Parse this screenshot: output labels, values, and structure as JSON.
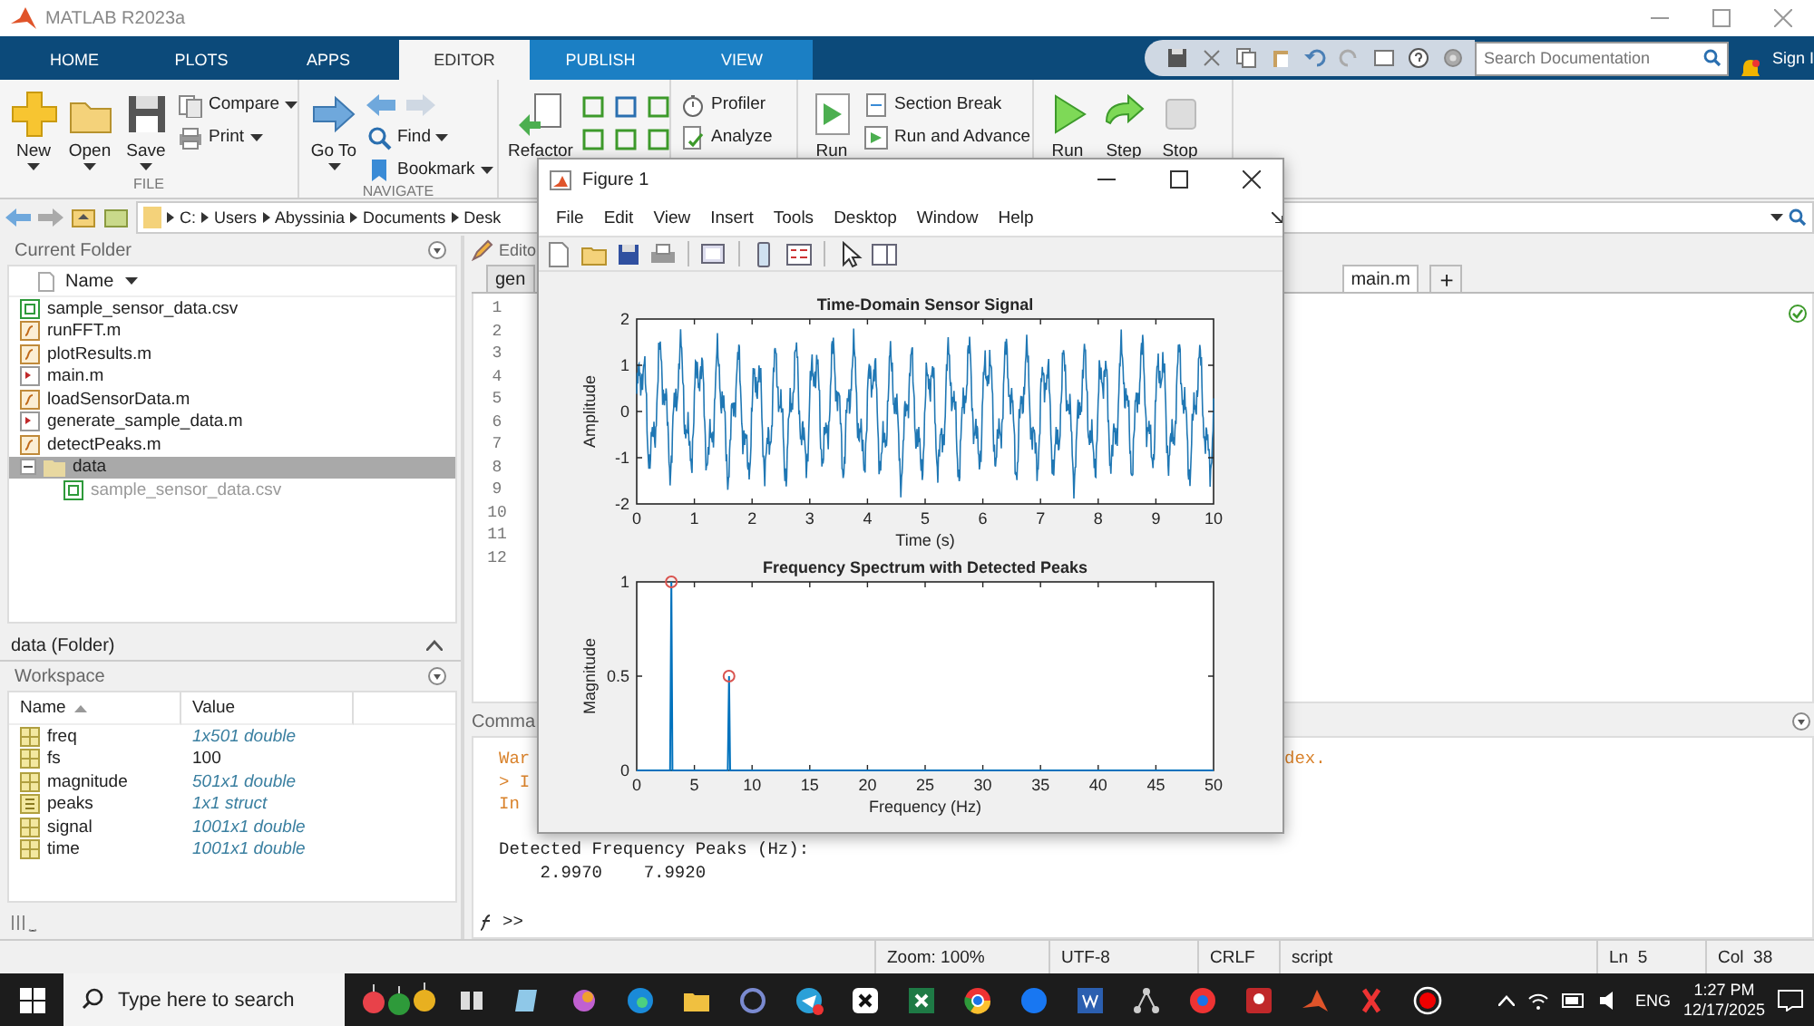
{
  "window": {
    "title": "MATLAB R2023a"
  },
  "ribbon": {
    "tabs": [
      {
        "label": "HOME",
        "selected": false,
        "contextual": false
      },
      {
        "label": "PLOTS",
        "selected": false,
        "contextual": false
      },
      {
        "label": "APPS",
        "selected": false,
        "contextual": false
      },
      {
        "label": "EDITOR",
        "selected": true,
        "contextual": true
      },
      {
        "label": "PUBLISH",
        "selected": false,
        "contextual": true
      },
      {
        "label": "VIEW",
        "selected": false,
        "contextual": true
      }
    ],
    "search": {
      "placeholder": "Search Documentation"
    },
    "sign_in": "Sign I",
    "groups": [
      {
        "label": "FILE",
        "items": [
          {
            "kind": "large",
            "label": "New",
            "menu": true
          },
          {
            "kind": "large",
            "label": "Open",
            "menu": true
          },
          {
            "kind": "large",
            "label": "Save",
            "menu": true
          },
          {
            "kind": "stack",
            "items": [
              {
                "kind": "button",
                "label": "Compare",
                "menu": true
              },
              {
                "kind": "button",
                "label": "Print",
                "menu": true
              }
            ]
          }
        ]
      },
      {
        "label": "NAVIGATE",
        "items": [
          {
            "kind": "large",
            "label": "Go To",
            "menu": true
          },
          {
            "kind": "stack",
            "items": [
              {
                "kind": "arrows"
              },
              {
                "kind": "button",
                "label": "Find",
                "menu": true
              },
              {
                "kind": "button",
                "label": "Bookmark",
                "menu": true
              }
            ]
          }
        ]
      },
      {
        "items": [
          {
            "kind": "large",
            "label": "Refactor",
            "menu": false
          },
          {
            "kind": "grid"
          }
        ]
      },
      {
        "items": [
          {
            "kind": "stack",
            "items": [
              {
                "kind": "button",
                "label": "Profiler",
                "menu": false
              },
              {
                "kind": "button",
                "label": "Analyze",
                "menu": false
              }
            ]
          }
        ]
      },
      {
        "items": [
          {
            "kind": "large",
            "label": "Run",
            "menu": false
          },
          {
            "kind": "stack",
            "items": [
              {
                "kind": "button",
                "label": "Section Break",
                "menu": false
              },
              {
                "kind": "button",
                "label": "Run and Advance",
                "menu": false
              }
            ]
          }
        ]
      },
      {
        "items": [
          {
            "kind": "large",
            "label": "Run",
            "menu": false
          },
          {
            "kind": "large",
            "label": "Step",
            "menu": false
          },
          {
            "kind": "large",
            "label": "Stop",
            "menu": false
          }
        ]
      }
    ]
  },
  "address": {
    "segments": [
      "C:",
      "Users",
      "Abyssinia",
      "Documents",
      "Desk"
    ]
  },
  "current_folder": {
    "title": "Current Folder",
    "column": "Name",
    "items": [
      {
        "name": "sample_sensor_data.csv",
        "kind": "csv",
        "selected": false
      },
      {
        "name": "runFFT.m",
        "kind": "function",
        "selected": false
      },
      {
        "name": "plotResults.m",
        "kind": "function",
        "selected": false
      },
      {
        "name": "main.m",
        "kind": "script",
        "selected": false
      },
      {
        "name": "loadSensorData.m",
        "kind": "function",
        "selected": false
      },
      {
        "name": "generate_sample_data.m",
        "kind": "script",
        "selected": false
      },
      {
        "name": "detectPeaks.m",
        "kind": "function",
        "selected": false
      },
      {
        "name": "data",
        "kind": "folder",
        "selected": true,
        "expanded": true,
        "children": [
          {
            "name": "sample_sensor_data.csv",
            "kind": "csv",
            "selected": false
          }
        ]
      }
    ],
    "details": "data  (Folder)"
  },
  "workspace": {
    "title": "Workspace",
    "columns": [
      {
        "label": "Name",
        "sorted": true
      },
      {
        "label": "Value",
        "sorted": false
      }
    ],
    "rows": [
      {
        "name": "freq",
        "value": "1x501 double",
        "kind": "matrix"
      },
      {
        "name": "fs",
        "value": "100",
        "kind": "scalar"
      },
      {
        "name": "magnitude",
        "value": "501x1 double",
        "kind": "matrix"
      },
      {
        "name": "peaks",
        "value": "1x1 struct",
        "kind": "struct"
      },
      {
        "name": "signal",
        "value": "1001x1 double",
        "kind": "matrix"
      },
      {
        "name": "time",
        "value": "1001x1 double",
        "kind": "matrix"
      }
    ]
  },
  "editor": {
    "title": "Edito",
    "tabs": [
      {
        "label": "gen",
        "selected": false
      },
      {
        "label": "main.m",
        "selected": true
      }
    ],
    "new_tab": "+",
    "line_numbers": [
      "1",
      "2",
      "3",
      "4",
      "5",
      "6",
      "7",
      "8",
      "9",
      "10",
      "11",
      "12"
    ]
  },
  "command_window": {
    "title": "Comma",
    "lines": [
      {
        "kind": "warning",
        "left": "War",
        "right": "dex."
      },
      {
        "kind": "warning",
        "left": "> I"
      },
      {
        "kind": "warning",
        "left": "In"
      },
      {
        "kind": "blank"
      },
      {
        "kind": "output",
        "left": "Detected Frequency Peaks (Hz):"
      },
      {
        "kind": "output",
        "left": "    2.9970    7.9920"
      }
    ],
    "prompt": ">>"
  },
  "status_bar": [
    "Zoom: 100%",
    "UTF-8",
    "CRLF",
    "script",
    "Ln  5",
    "Col  38"
  ],
  "figure": {
    "title": "Figure 1",
    "menu": [
      "File",
      "Edit",
      "View",
      "Insert",
      "Tools",
      "Desktop",
      "Window",
      "Help"
    ],
    "time_plot": {
      "title": "Time-Domain Sensor Signal",
      "xlabel": "Time (s)",
      "ylabel": "Amplitude",
      "xticks": [
        "0",
        "1",
        "2",
        "3",
        "4",
        "5",
        "6",
        "7",
        "8",
        "9",
        "10"
      ],
      "yticks": [
        "2",
        "1",
        "0",
        "-1",
        "-2"
      ]
    },
    "spectrum": {
      "chart_data": {
        "type": "line",
        "title": "Frequency Spectrum with Detected Peaks",
        "xlabel": "Frequency (Hz)",
        "ylabel": "Magnitude",
        "x": [
          0,
          2.9,
          3,
          3.1,
          7.9,
          8,
          8.1,
          50
        ],
        "series": [
          {
            "color": "#0072bd",
            "values": [
              0,
              0,
              1,
              0,
              0,
              0.5,
              0,
              0
            ]
          }
        ],
        "xlim": [
          0,
          50
        ],
        "ylim": [
          0,
          1
        ],
        "xticks": [
          0,
          5,
          10,
          15,
          20,
          25,
          30,
          35,
          40,
          45,
          50
        ],
        "yticks": [
          0,
          0.5,
          1
        ]
      }
    }
  },
  "taskbar": {
    "search": {
      "placeholder": "Type here to search"
    },
    "language": "ENG",
    "time": "1:27 PM",
    "date": "12/17/2025"
  }
}
